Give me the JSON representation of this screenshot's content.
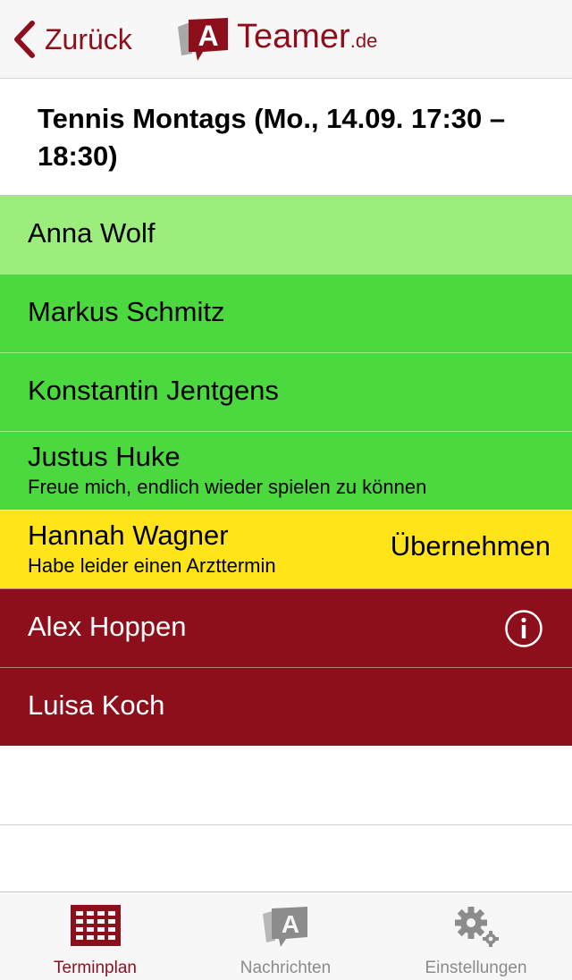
{
  "colors": {
    "brand": "#8e0f1c",
    "accepted_light": "#9ced7c",
    "accepted": "#4cd93f",
    "maybe": "#ffe41a",
    "declined": "#8e0f1c"
  },
  "navbar": {
    "back_label": "Zurück",
    "logo_letter": "A",
    "brand_word": "Teamer",
    "brand_tld": ".de"
  },
  "event": {
    "title": "Tennis Montags (Mo., 14.09. 17:30 – 18:30)"
  },
  "participants": [
    {
      "name": "Anna Wolf",
      "comment": "",
      "status": "accepted_light"
    },
    {
      "name": "Markus Schmitz",
      "comment": "",
      "status": "accepted"
    },
    {
      "name": "Konstantin Jentgens",
      "comment": "",
      "status": "accepted"
    },
    {
      "name": "Justus Huke",
      "comment": "Freue mich, endlich wieder spielen zu können",
      "status": "accepted"
    },
    {
      "name": "Hannah Wagner",
      "comment": "Habe leider einen Arzttermin",
      "status": "maybe",
      "action_label": "Übernehmen"
    },
    {
      "name": "Alex Hoppen",
      "comment": "",
      "status": "declined",
      "icon": "info-icon"
    },
    {
      "name": "Luisa Koch",
      "comment": "",
      "status": "declined"
    }
  ],
  "tabbar": {
    "tabs": [
      {
        "label": "Terminplan",
        "icon": "calendar-grid-icon",
        "active": true
      },
      {
        "label": "Nachrichten",
        "icon": "messages-icon",
        "active": false
      },
      {
        "label": "Einstellungen",
        "icon": "gear-icon",
        "active": false
      }
    ]
  }
}
